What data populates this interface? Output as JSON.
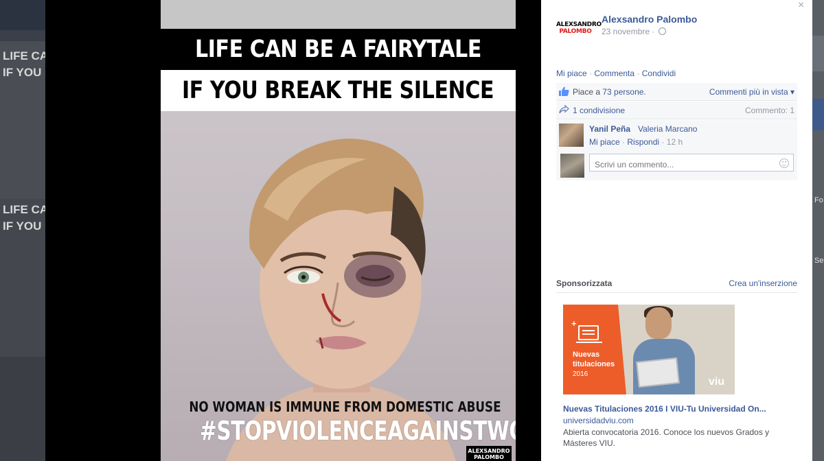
{
  "viewer": {
    "poster": {
      "headline_line1": "LIFE CAN BE A FAIRYTALE",
      "headline_line2": "IF YOU BREAK THE SILENCE",
      "caption_line1": "NO WOMAN IS IMMUNE FROM DOMESTIC ABUSE",
      "caption_line2": "#STOPVIOLENCEAGAINSTWOMEN",
      "logo_line1": "ALEXSANDRO",
      "logo_line2": "PALOMBO"
    }
  },
  "background_page": {
    "left_text_1": "LIFE CA",
    "left_text_2": "IF YOU I",
    "left_text_3": "LIFE CA",
    "left_text_4": "IF YOU I",
    "right_text_1": "Fo",
    "right_text_2": "Se"
  },
  "post": {
    "author_logo_line1": "ALEXSANDRO",
    "author_logo_line2": "PALOMBO",
    "author_name": "Alexsandro Palombo",
    "date": "23 novembre",
    "date_separator": "·",
    "close_icon_glyph": "×",
    "actions": {
      "like": "Mi piace",
      "comment": "Commenta",
      "share": "Condividi",
      "separator": "·"
    },
    "likes": {
      "prefix": "Piace a",
      "count": "73 persone",
      "suffix": ".",
      "sort": "Commenti più in vista ▾"
    },
    "shares": {
      "text": "1 condivisione",
      "comment_count": "Commento: 1"
    },
    "comment": {
      "author": "Yanil Peña",
      "text": "Valeria Marcano",
      "like": "Mi piace",
      "reply": "Rispondi",
      "time": "12 h",
      "separator": "·"
    },
    "comment_input": {
      "placeholder": "Scrivi un commento..."
    }
  },
  "sponsored": {
    "label": "Sponsorizzata",
    "create_ad": "Crea un'inserzione",
    "ad": {
      "image_plus": "+",
      "image_line1": "Nuevas",
      "image_line2": "titulaciones",
      "image_year": "2016",
      "image_brand": "viu",
      "title": "Nuevas Titulaciones 2016 I VIU-Tu Universidad On...",
      "url": "universidadviu.com",
      "description": "Abierta convocatoria 2016. Conoce los nuevos Grados y Másteres VIU."
    }
  },
  "colors": {
    "link": "#3b5998",
    "muted": "#9197a3",
    "ad_orange": "#ec5d29",
    "logo_red": "#e01a1a"
  }
}
